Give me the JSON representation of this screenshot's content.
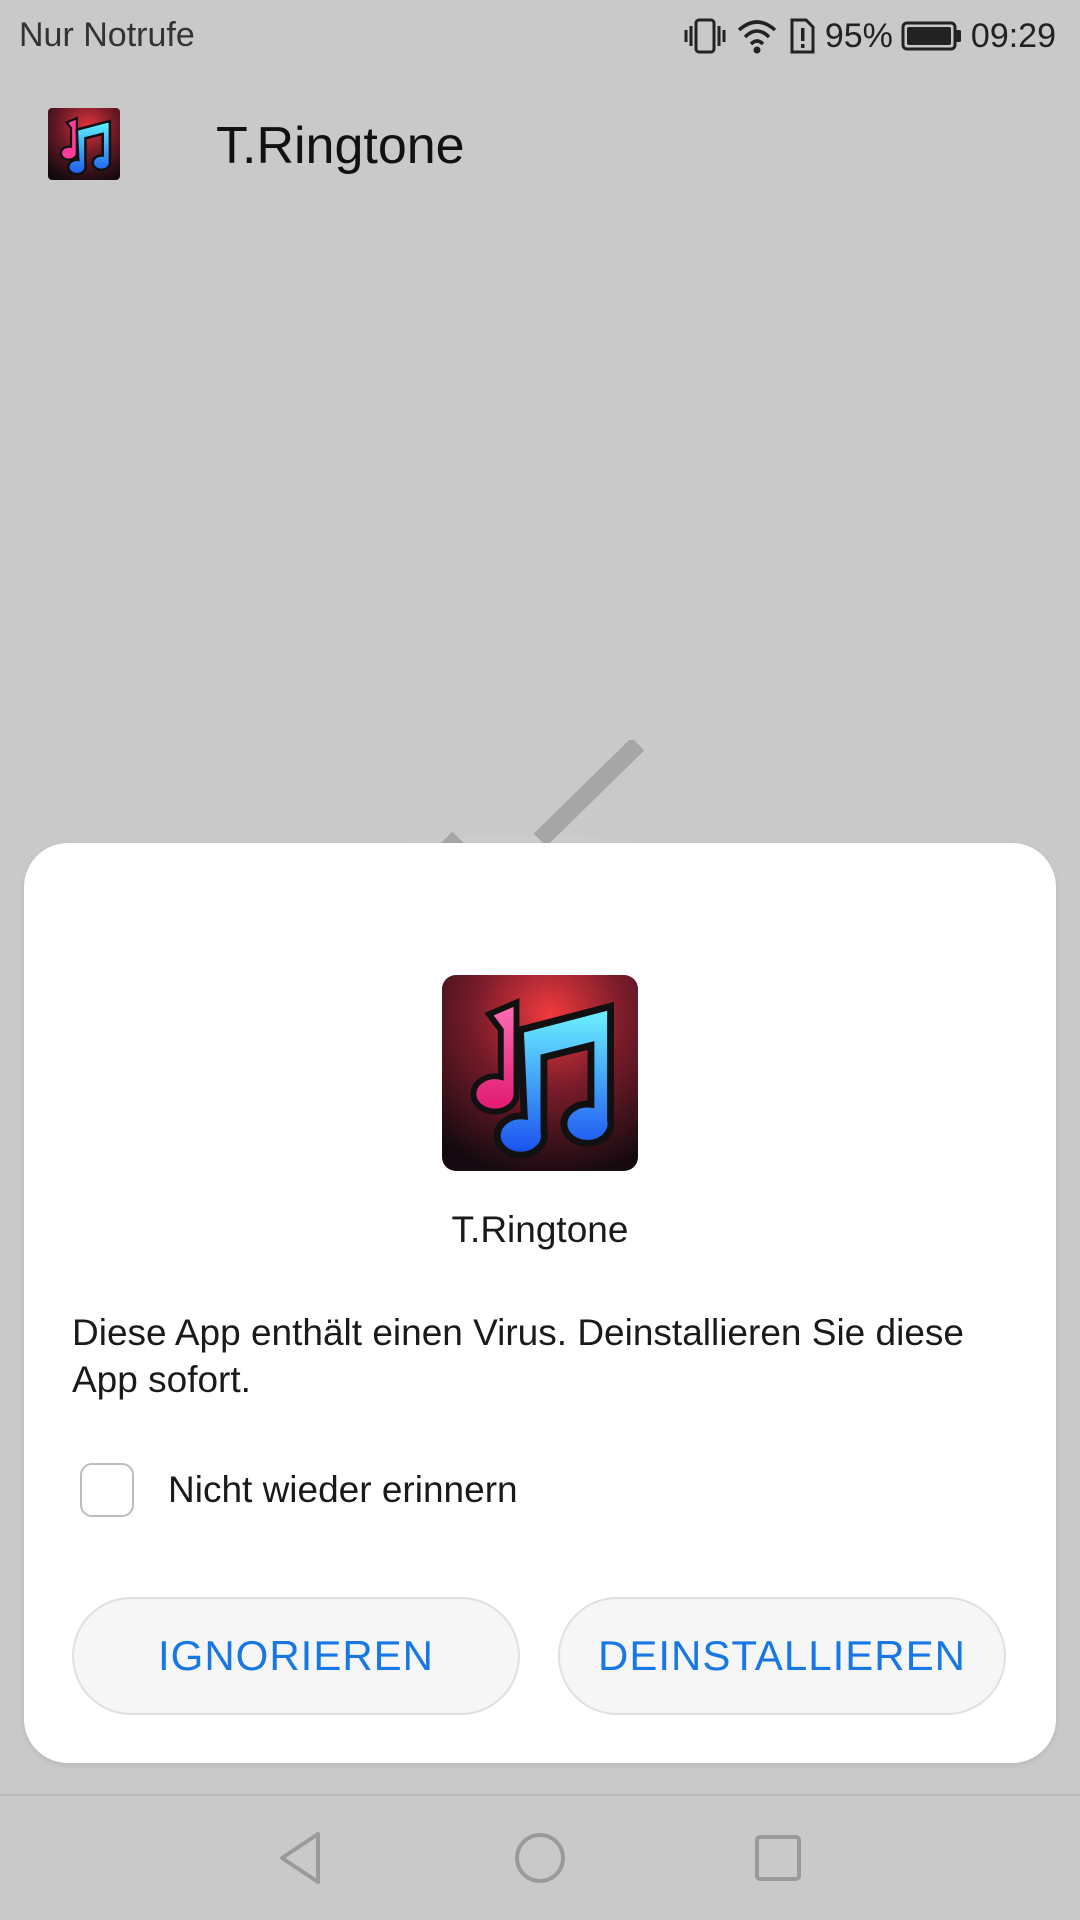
{
  "status_bar": {
    "carrier": "Nur Notrufe",
    "battery_percent": "95%",
    "time": "09:29",
    "icons": [
      "vibrate-icon",
      "wifi-icon",
      "battery-alert-icon",
      "battery-icon"
    ]
  },
  "app_bar": {
    "title": "T.Ringtone",
    "icon": "music-notes-app-icon"
  },
  "dialog": {
    "app_name": "T.Ringtone",
    "message": "Diese App enthält einen Virus. Deinstallieren Sie diese App sofort.",
    "checkbox_label": "Nicht wieder erinnern",
    "checkbox_checked": false,
    "ignore_label": "IGNORIEREN",
    "uninstall_label": "DEINSTALLIEREN"
  },
  "nav_bar": {
    "icons": [
      "back-icon",
      "home-icon",
      "recents-icon"
    ]
  },
  "colors": {
    "accent": "#1677e5",
    "background": "#c9c9c9",
    "dialog": "#ffffff"
  }
}
